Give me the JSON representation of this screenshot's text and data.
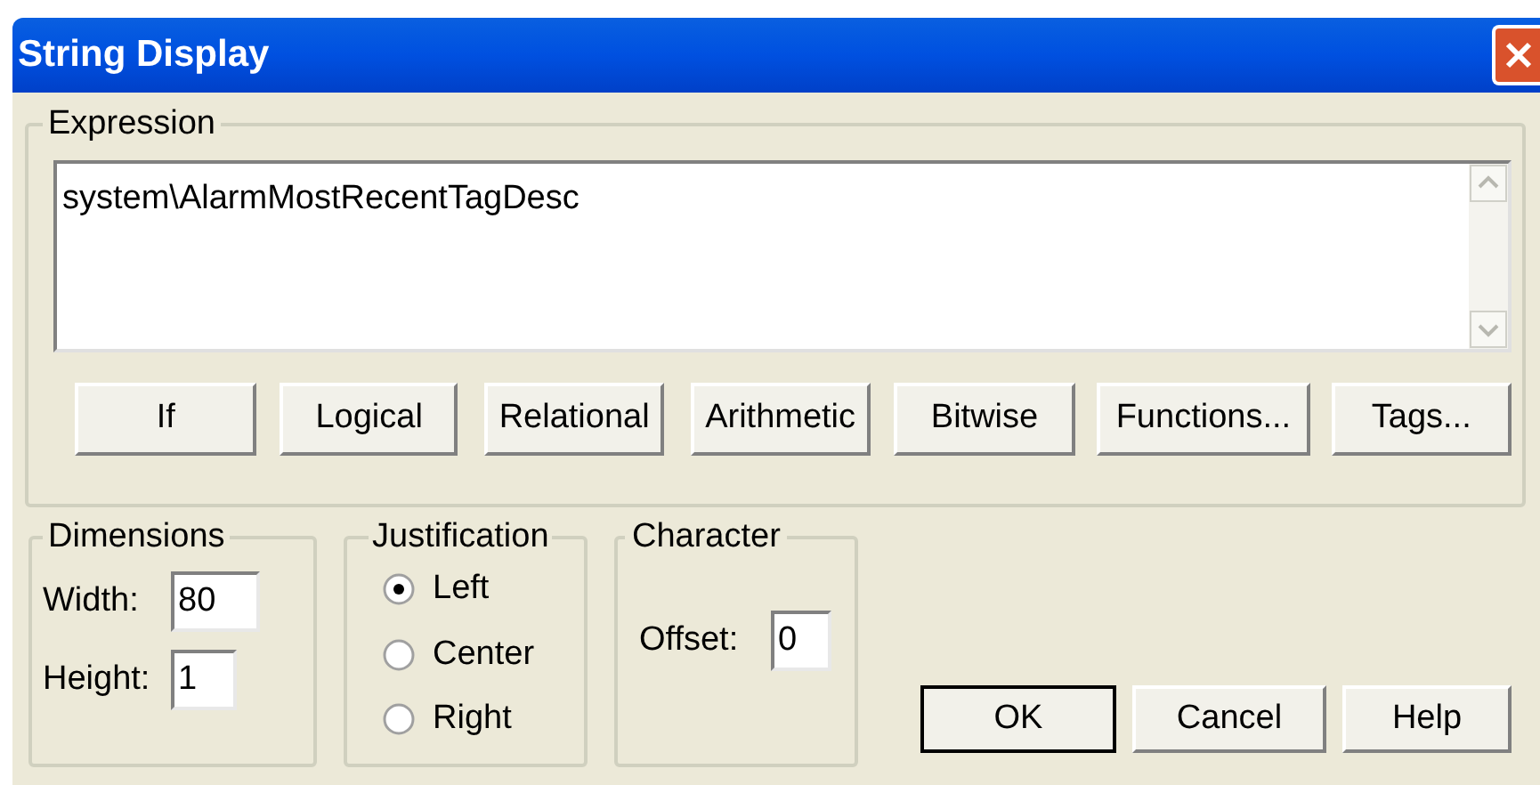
{
  "window": {
    "title": "String Display"
  },
  "expression": {
    "label": "Expression",
    "value": "system\\AlarmMostRecentTagDesc"
  },
  "operator_buttons": [
    "If",
    "Logical",
    "Relational",
    "Arithmetic",
    "Bitwise",
    "Functions...",
    "Tags..."
  ],
  "dimensions": {
    "label": "Dimensions",
    "fields": [
      {
        "label": "Width:",
        "value": "80"
      },
      {
        "label": "Height:",
        "value": "1"
      }
    ]
  },
  "justification": {
    "label": "Justification",
    "options": [
      {
        "label": "Left",
        "selected": true
      },
      {
        "label": "Center",
        "selected": false
      },
      {
        "label": "Right",
        "selected": false
      }
    ]
  },
  "character": {
    "label": "Character",
    "fields": [
      {
        "label": "Offset:",
        "value": "0"
      }
    ]
  },
  "buttons": [
    {
      "label": "OK",
      "default": true
    },
    {
      "label": "Cancel",
      "default": false
    },
    {
      "label": "Help",
      "default": false
    }
  ]
}
